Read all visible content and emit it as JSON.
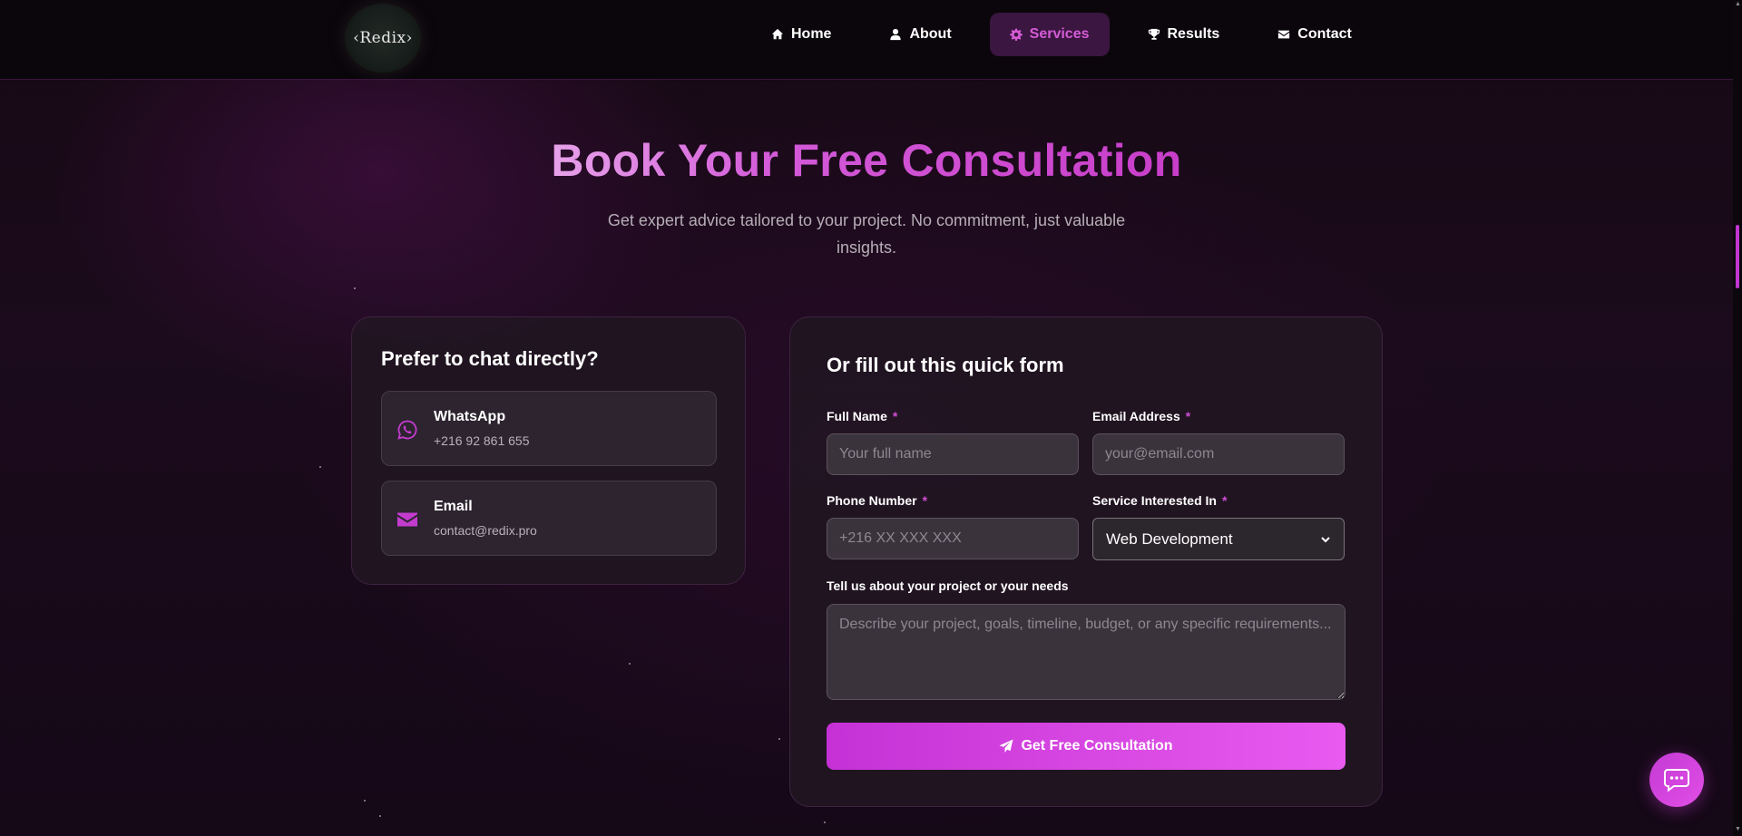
{
  "brand": {
    "logo_text": "‹Redix›"
  },
  "nav": [
    {
      "label": "Home",
      "icon": "home-icon"
    },
    {
      "label": "About",
      "icon": "user-icon"
    },
    {
      "label": "Services",
      "icon": "gear-icon",
      "active": true
    },
    {
      "label": "Results",
      "icon": "trophy-icon"
    },
    {
      "label": "Contact",
      "icon": "envelope-icon"
    }
  ],
  "hero": {
    "title": "Book Your Free Consultation",
    "subtitle": "Get expert advice tailored to your project. No commitment, just valuable insights."
  },
  "chat": {
    "title": "Prefer to chat directly?",
    "whatsapp": {
      "label": "WhatsApp",
      "value": "+216 92 861 655",
      "icon": "whatsapp-icon"
    },
    "email": {
      "label": "Email",
      "value": "contact@redix.pro",
      "icon": "envelope-icon"
    }
  },
  "form": {
    "title": "Or fill out this quick form",
    "required_mark": "*",
    "full_name": {
      "label": "Full Name",
      "placeholder": "Your full name",
      "value": ""
    },
    "email": {
      "label": "Email Address",
      "placeholder": "your@email.com",
      "value": ""
    },
    "phone": {
      "label": "Phone Number",
      "placeholder": "+216 XX XXX XXX",
      "value": ""
    },
    "service": {
      "label": "Service Interested In",
      "selected": "Web Development"
    },
    "project": {
      "label": "Tell us about your project or your needs",
      "placeholder": "Describe your project, goals, timeline, budget, or any specific requirements..."
    },
    "submit_label": "Get Free Consultation"
  },
  "colors": {
    "accent": "#d04ed6",
    "background": "#150a16",
    "card": "#221622"
  }
}
